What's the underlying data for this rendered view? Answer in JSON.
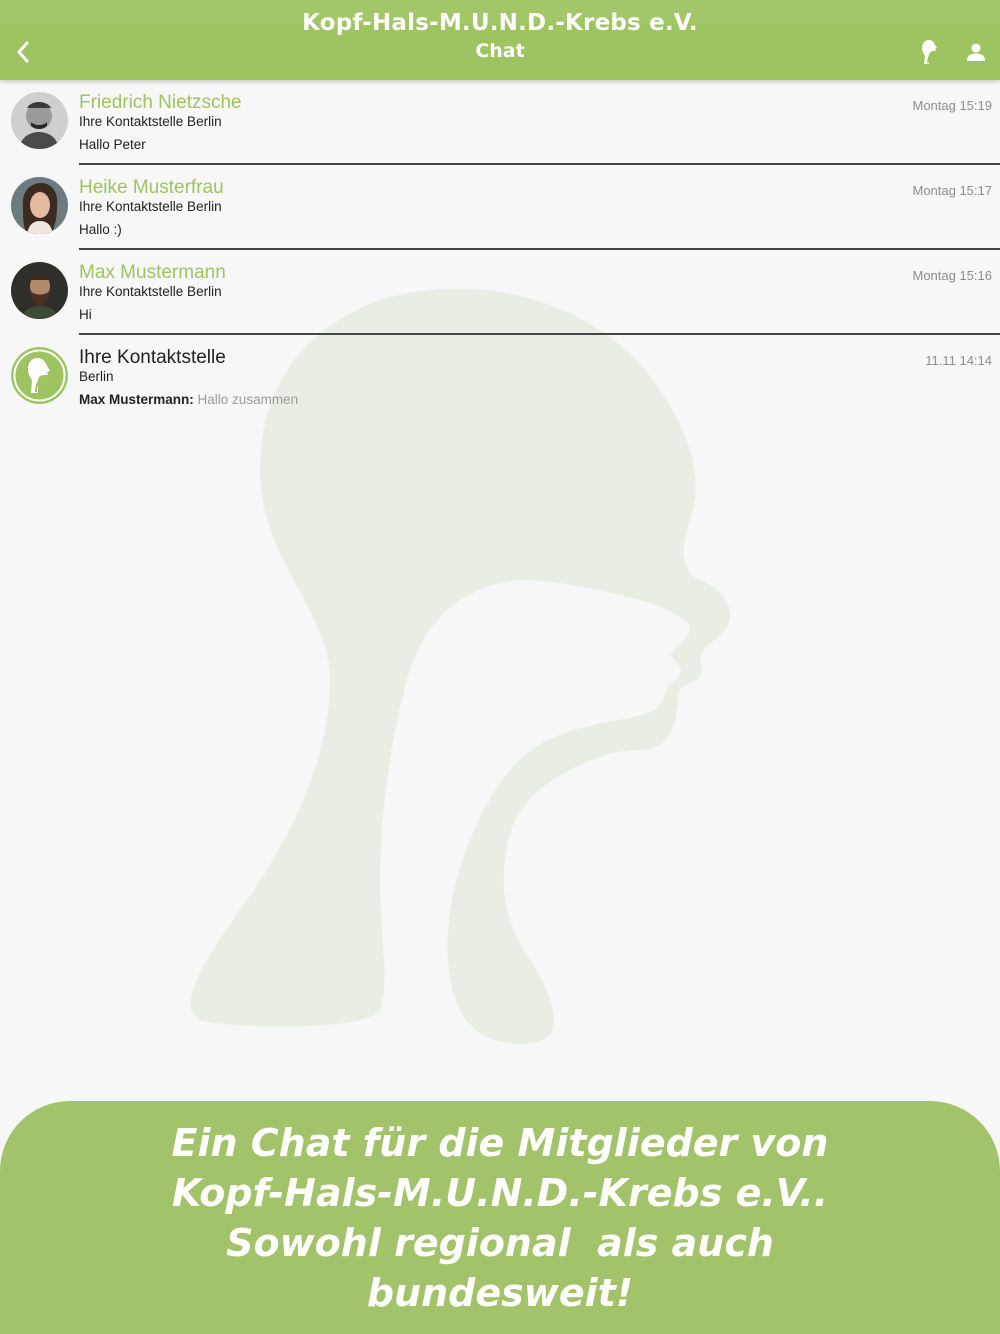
{
  "header": {
    "app_title": "Kopf-Hals-M.U.N.D.-Krebs e.V.",
    "page_title": "Chat",
    "icons": {
      "back": "chevron-left-icon",
      "logo": "organization-logo-icon",
      "profile": "person-icon"
    }
  },
  "colors": {
    "brand_green": "#9dc460",
    "banner_green": "#a2c36a",
    "muted_text": "#8d8d8d"
  },
  "chats": [
    {
      "name": "Friedrich Nietzsche",
      "subtitle": "Ihre Kontaktstelle Berlin",
      "preview": "Hallo Peter",
      "time": "Montag 15:19",
      "avatar": "portrait-avatar"
    },
    {
      "name": "Heike Musterfrau",
      "subtitle": "Ihre Kontaktstelle Berlin",
      "preview": "Hallo :)",
      "time": "Montag 15:17",
      "avatar": "portrait-avatar"
    },
    {
      "name": "Max Mustermann",
      "subtitle": "Ihre Kontaktstelle Berlin",
      "preview": "Hi",
      "time": "Montag 15:16",
      "avatar": "portrait-avatar"
    },
    {
      "name": "Ihre Kontaktstelle",
      "subtitle": "Berlin",
      "preview_sender": "Max Mustermann:",
      "preview": "Hallo zusammen",
      "time": "11.11 14:14",
      "avatar": "organization-logo-avatar"
    }
  ],
  "banner": {
    "lines": [
      "Ein Chat für die Mitglieder von",
      "Kopf-Hals-M.U.N.D.-Krebs e.V..",
      "Sowohl regional  als auch",
      "bundesweit!"
    ]
  }
}
